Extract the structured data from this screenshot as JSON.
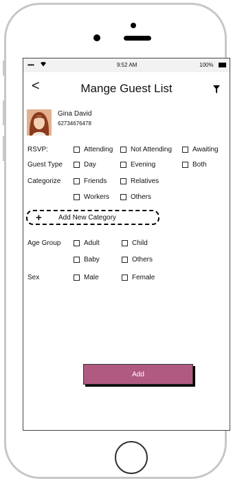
{
  "status_bar": {
    "signal": "•••••",
    "time": "9:52 AM",
    "battery": "100%"
  },
  "header": {
    "back": "<",
    "title": "Mange Guest List"
  },
  "guest": {
    "name": "Gina David",
    "phone": "62734676478"
  },
  "form": {
    "rsvp": {
      "label": "RSVP:",
      "options": [
        "Attending",
        "Not Attending",
        "Awaiting"
      ]
    },
    "guest_type": {
      "label": "Guest Type",
      "options": [
        "Day",
        "Evening",
        "Both"
      ]
    },
    "categorize": {
      "label": "Categorize",
      "options": [
        "Friends",
        "Relatives",
        "Workers",
        "Others"
      ]
    },
    "add_category": {
      "icon": "+",
      "label": "Add New Category"
    },
    "age_group": {
      "label": "Age Group",
      "options": [
        "Adult",
        "Child",
        "Baby",
        "Others"
      ]
    },
    "sex": {
      "label": "Sex",
      "options": [
        "Male",
        "Female"
      ]
    }
  },
  "add_button": {
    "label": "Add"
  },
  "colors": {
    "add_button": "#b05a82",
    "status_bar_bg": "#f2f2f2",
    "phone_frame": "#c7c7c7"
  },
  "icons": [
    "signal-icon",
    "wifi-icon",
    "battery-icon",
    "back-arrow-icon",
    "filter-icon",
    "plus-icon",
    "avatar-photo",
    "home-button"
  ]
}
